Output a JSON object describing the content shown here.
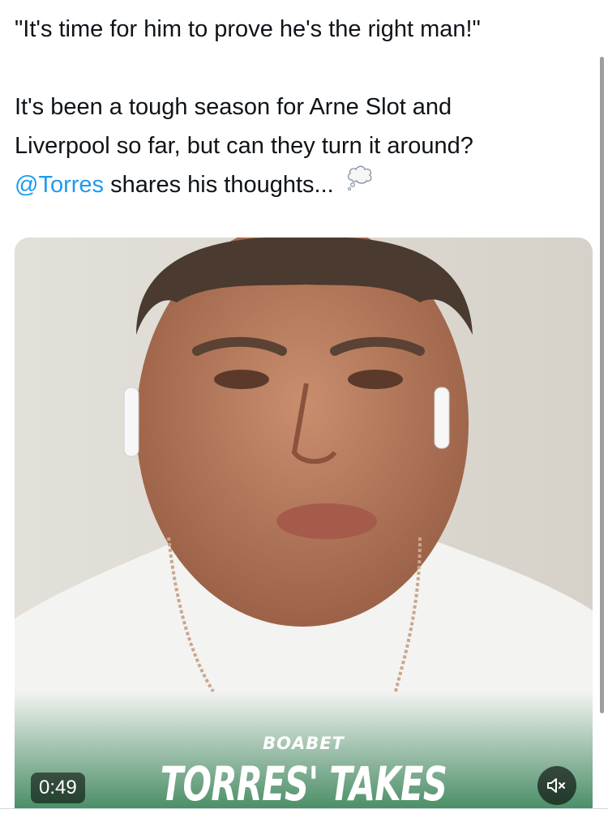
{
  "tweet": {
    "line1": "\"It's time for him to prove he's the right man!\"",
    "line2": "It's been a tough season for Arne Slot and",
    "line3": "Liverpool so far, but can they turn it around?",
    "mention": "@Torres",
    "line4_rest": " shares his thoughts...",
    "emoji_icon": "thought-balloon-icon"
  },
  "video": {
    "duration": "0:49",
    "brand_small": "BOABET",
    "brand_title": "TORRES' TAKES",
    "mute_icon": "speaker-muted-icon"
  },
  "colors": {
    "text": "#0f1419",
    "mention": "#1d9bf0",
    "overlay_green": "#2e7d4f"
  }
}
